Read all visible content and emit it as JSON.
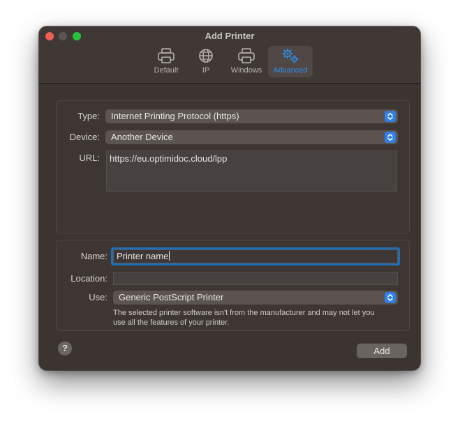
{
  "window": {
    "title": "Add Printer"
  },
  "toolbar": {
    "tabs": [
      {
        "label": "Default",
        "icon": "printer-icon"
      },
      {
        "label": "IP",
        "icon": "globe-icon"
      },
      {
        "label": "Windows",
        "icon": "printer-icon"
      },
      {
        "label": "Advanced",
        "icon": "gears-icon"
      }
    ],
    "selected": "Advanced"
  },
  "connection": {
    "type_label": "Type:",
    "type_value": "Internet Printing Protocol (https)",
    "device_label": "Device:",
    "device_value": "Another Device",
    "url_label": "URL:",
    "url_value": "https://eu.optimidoc.cloud/lpp"
  },
  "printer": {
    "name_label": "Name:",
    "name_value": "Printer name",
    "location_label": "Location:",
    "location_value": "",
    "use_label": "Use:",
    "use_value": "Generic PostScript Printer",
    "note_line1": "The selected printer software isn't from the manufacturer and may not let you",
    "note_line2": "use all the features of your printer."
  },
  "footer": {
    "help": "?",
    "add_label": "Add"
  },
  "colors": {
    "accent": "#2f80e8",
    "focus_ring": "#1e6fb5",
    "close": "#ee5f57",
    "zoom": "#29c33f"
  }
}
